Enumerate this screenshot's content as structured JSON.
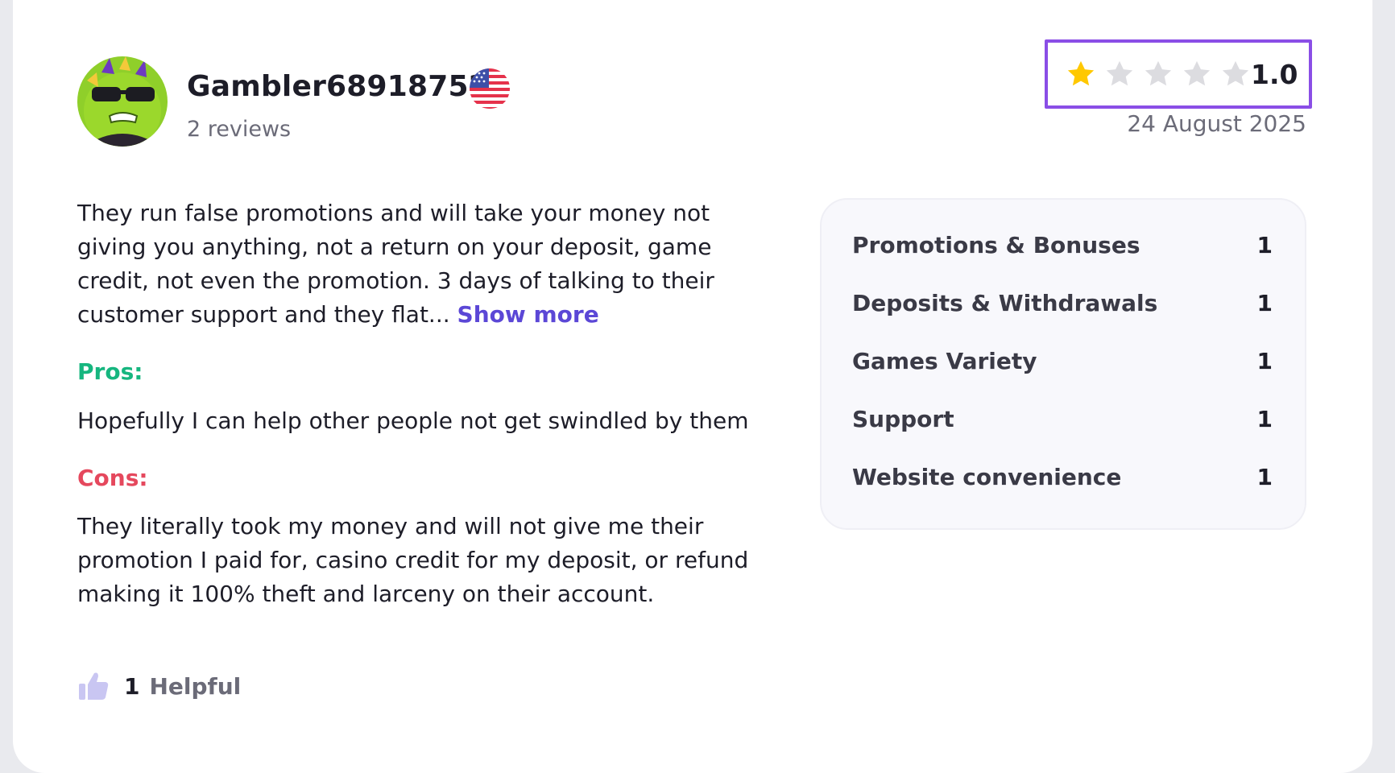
{
  "reviewer": {
    "username": "Gambler68918752",
    "review_count": "2 reviews",
    "avatar_icon": "green-cactus-sunglasses-avatar",
    "country_flag_icon": "us-flag-icon"
  },
  "rating": {
    "value": "1.0",
    "stars_filled": 1,
    "stars_total": 5,
    "star_color": "#ffc800",
    "empty_star_color": "#dcdce0",
    "date": "24 August 2025"
  },
  "review": {
    "text": "They run false promotions and will take your money not giving you anything, not a return on your deposit, game credit, not even the promotion. 3 days of talking to their customer support and they flat... ",
    "show_more": "Show more",
    "pros_label": "Pros:",
    "pros_text": "Hopefully I can help other people not get swindled by them",
    "cons_label": "Cons:",
    "cons_text": "They literally took my money and will not give me their promotion I paid for, casino credit for my deposit, or refund making it 100% theft and larceny on their account."
  },
  "helpful": {
    "count": "1",
    "label": "Helpful"
  },
  "scores": [
    {
      "label": "Promotions & Bonuses",
      "value": "1"
    },
    {
      "label": "Deposits & Withdrawals",
      "value": "1"
    },
    {
      "label": "Games Variety",
      "value": "1"
    },
    {
      "label": "Support",
      "value": "1"
    },
    {
      "label": "Website convenience",
      "value": "1"
    }
  ],
  "colors": {
    "accent_purple": "#8a4ee6",
    "link": "#5b47d6",
    "pros": "#16b67f",
    "cons": "#e5485d"
  }
}
